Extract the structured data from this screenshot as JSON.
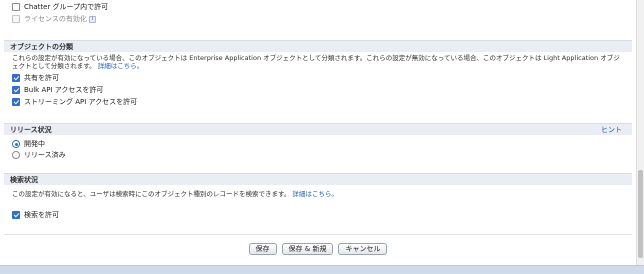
{
  "top": {
    "items": [
      {
        "label": "Chatter グループ内で許可",
        "checked": false,
        "disabled": false
      },
      {
        "label": "ライセンスの有効化",
        "checked": false,
        "disabled": true,
        "info": "i"
      }
    ]
  },
  "classification": {
    "title": "オブジェクトの分類",
    "description": "これらの設定が有効になっている場合、このオブジェクトは Enterprise Application オブジェクトとして分類されます。これらの設定が無効になっている場合、このオブジェクトは Light Application オブジェクトとして分類されます。",
    "link": "詳細はこちら。",
    "items": [
      {
        "label": "共有を許可",
        "checked": true
      },
      {
        "label": "Bulk API アクセスを許可",
        "checked": true
      },
      {
        "label": "ストリーミング API アクセスを許可",
        "checked": true
      }
    ]
  },
  "release": {
    "title": "リリース状況",
    "help": "ヒント",
    "options": [
      {
        "label": "開発中",
        "selected": true
      },
      {
        "label": "リリース済み",
        "selected": false
      }
    ]
  },
  "search": {
    "title": "検索状況",
    "description": "この設定が有効になると、ユーザは検索時にこのオブジェクト種別のレコードを検索できます。",
    "link": "詳細はこちら。",
    "item": {
      "label": "検索を許可",
      "checked": true
    }
  },
  "buttons": {
    "save": "保存",
    "save_new": "保存 & 新規",
    "cancel": "キャンセル"
  },
  "colors": {
    "accent": "#2f6fcf",
    "link": "#1f5fb5",
    "section_bg": "#eaeef4"
  }
}
